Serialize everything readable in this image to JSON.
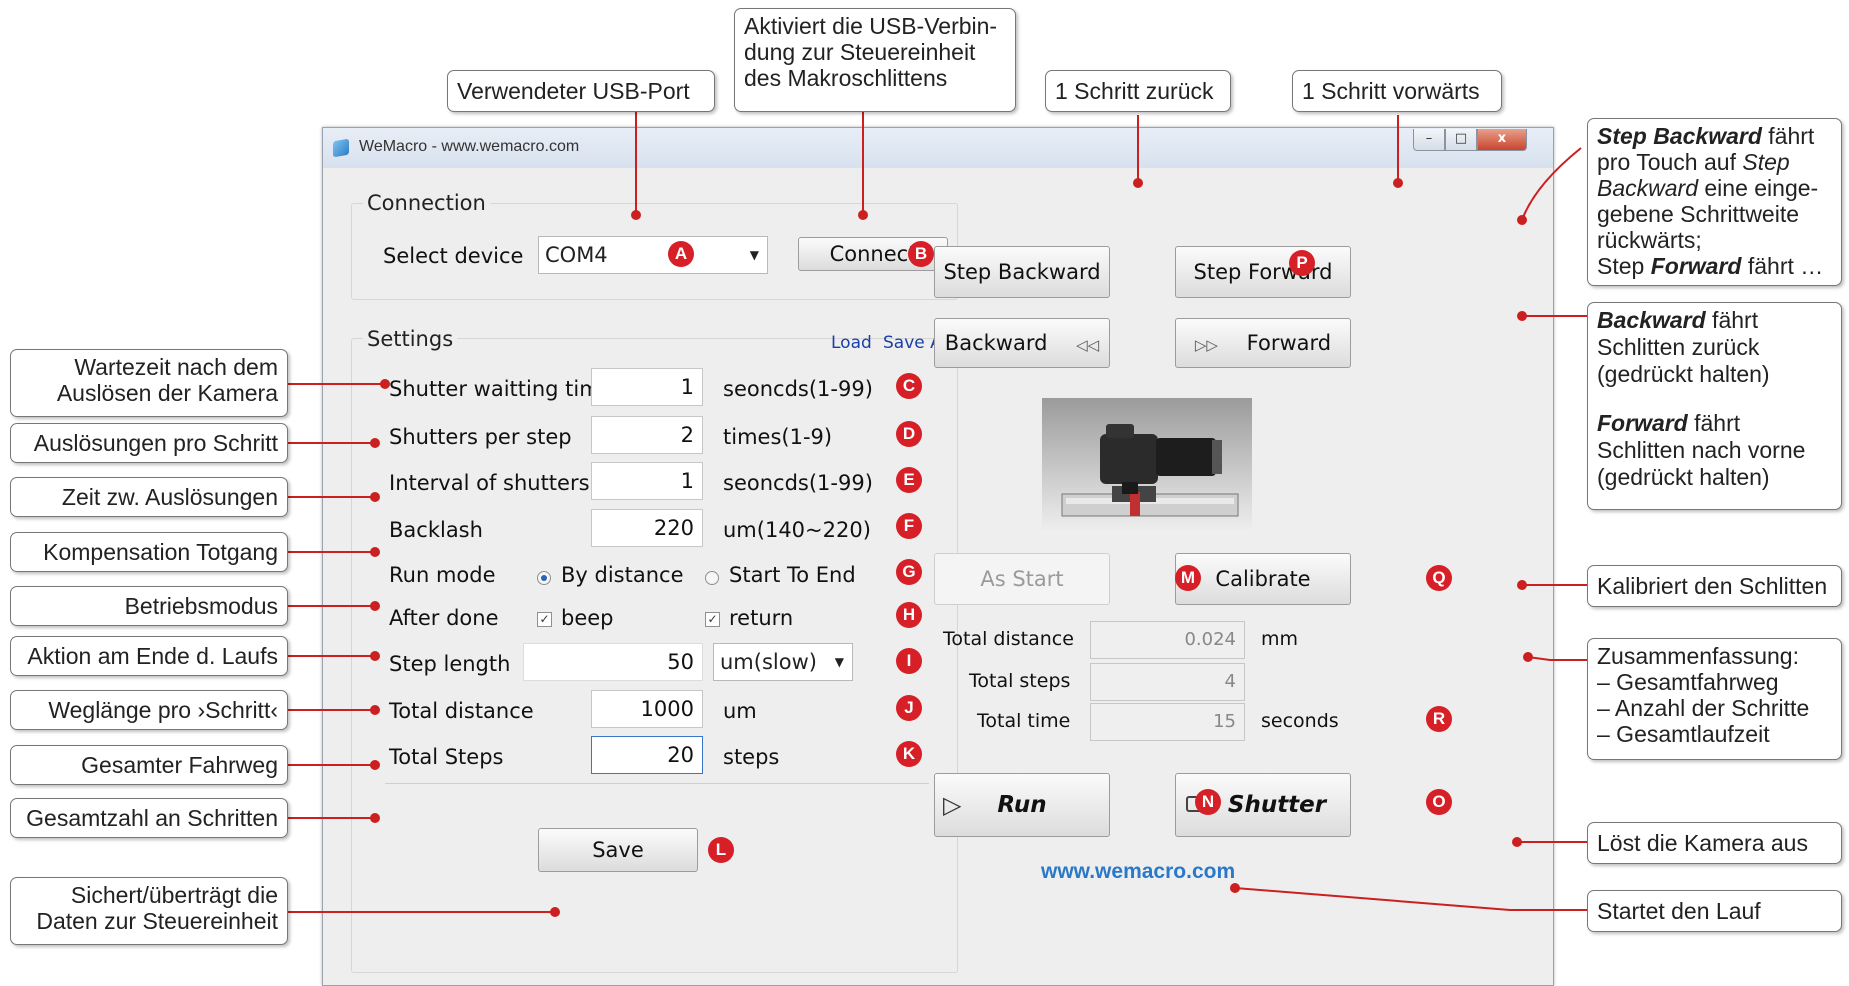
{
  "colors": {
    "badge": "#d61f26",
    "leader": "#cc1f1f",
    "link": "#1a3fa8",
    "website": "#2a79c9"
  },
  "callouts": {
    "usb_port": "Verwendeter USB-Port",
    "connect_line1": "Aktiviert die USB-Verbin-",
    "connect_line2": "dung zur Steuereinheit",
    "connect_line3": "des Makroschlittens",
    "step_back": "1 Schritt zurück",
    "step_fwd": "1 Schritt vorwärts",
    "stepinfo": {
      "l1_b": "Step Backward",
      "l1_r": " fährt",
      "l2_r": "pro Touch auf ",
      "l2_i": "Step",
      "l3_i": "Backward",
      "l3_r": " eine einge-",
      "l4": "gebene Schrittweite",
      "l5": "rückwärts;",
      "l6_r": "Step ",
      "l6_b": "Forward",
      "l6_r2": " fährt …"
    },
    "moveinfo": {
      "b1": "Backward",
      "r1": " fährt",
      "l2": "Schlitten zurück",
      "l3": "(gedrückt halten)",
      "b2": "Forward",
      "r2": " fährt",
      "l5": "Schlitten nach vorne",
      "l6": "(gedrückt halten)"
    },
    "calibrate": "Kalibriert den Schlitten",
    "summary": [
      "Zusammenfassung:",
      "– Gesamtfahrweg",
      "– Anzahl der Schritte",
      "– Gesamtlaufzeit"
    ],
    "shutter": "Löst die Kamera aus",
    "run": "Startet den Lauf",
    "wait_l1": "Wartezeit nach dem",
    "wait_l2": "Auslösen der Kamera",
    "shutters": "Auslösungen pro Schritt",
    "interval": "Zeit zw. Auslösungen",
    "backlash": "Kompensation Totgang",
    "mode": "Betriebsmodus",
    "after": "Aktion am Ende d. Laufs",
    "steplen": "Weglänge pro ›Schritt‹",
    "totaldist": "Gesamter Fahrweg",
    "totalsteps": "Gesamtzahl an Schritten",
    "save_l1": "Sichert/überträgt die",
    "save_l2": "Daten zur Steuereinheit"
  },
  "window": {
    "title": "WeMacro - www.wemacro.com",
    "controls": {
      "min": "–",
      "max": "□",
      "close": "x"
    }
  },
  "connection": {
    "label": "Connection",
    "select_label": "Select device",
    "device": "COM4",
    "connect": "Connect"
  },
  "settings": {
    "label": "Settings",
    "load": "Load",
    "save_as": "Save As",
    "shutter_wait": {
      "label": "Shutter waitting time",
      "value": "1",
      "unit": "seoncds(1-99)"
    },
    "shutters_per_step": {
      "label": "Shutters per step",
      "value": "2",
      "unit": "times(1-9)"
    },
    "interval": {
      "label": "Interval of shutters",
      "value": "1",
      "unit": "seoncds(1-99)"
    },
    "backlash": {
      "label": "Backlash",
      "value": "220",
      "unit": "um(140~220)"
    },
    "run_mode": {
      "label": "Run mode",
      "opt1": "By distance",
      "opt2": "Start To End"
    },
    "after_done": {
      "label": "After done",
      "opt1": "beep",
      "opt2": "return"
    },
    "step_length": {
      "label": "Step length",
      "value": "50",
      "speed": "um(slow)"
    },
    "total_distance": {
      "label": "Total distance",
      "value": "1000",
      "unit": "um"
    },
    "total_steps": {
      "label": "Total Steps",
      "value": "20",
      "unit": "steps"
    },
    "save": "Save"
  },
  "controls": {
    "step_backward": "Step Backward",
    "step_forward": "Step Forward",
    "backward": "Backward",
    "forward": "Forward",
    "as_start": "As Start",
    "calibrate": "Calibrate",
    "run": "Run",
    "shutter": "Shutter"
  },
  "summary": {
    "total_distance": {
      "label": "Total distance",
      "value": "0.024",
      "unit": "mm"
    },
    "total_steps": {
      "label": "Total steps",
      "value": "4"
    },
    "total_time": {
      "label": "Total time",
      "value": "15",
      "unit": "seconds"
    }
  },
  "website": "www.wemacro.com",
  "badges": {
    "A": "A",
    "B": "B",
    "C": "C",
    "D": "D",
    "E": "E",
    "F": "F",
    "G": "G",
    "H": "H",
    "I": "I",
    "J": "J",
    "K": "K",
    "L": "L",
    "M": "M",
    "N": "N",
    "O": "O",
    "P": "P",
    "Q": "Q",
    "R": "R"
  }
}
